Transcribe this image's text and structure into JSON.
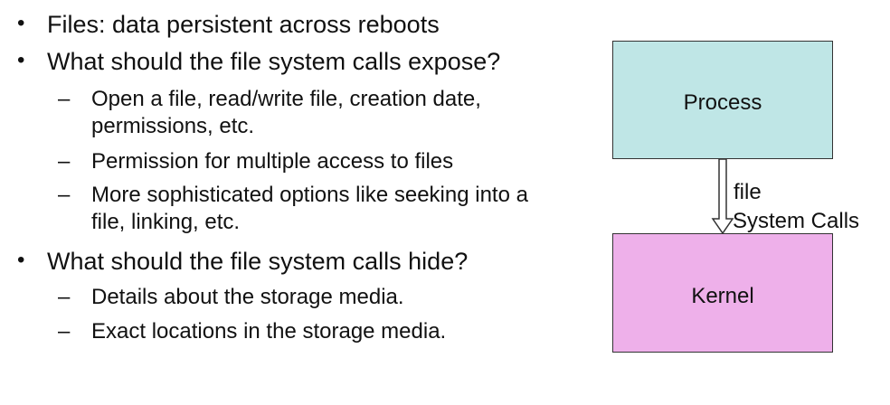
{
  "bullets": [
    {
      "text": "Files: data persistent across reboots"
    },
    {
      "text": "What should the file system calls expose?"
    },
    {
      "text": "What should the file system calls hide?"
    }
  ],
  "expose_items": [
    {
      "lines": [
        "Open a file, read/write file, creation date,",
        "permissions, etc."
      ]
    },
    {
      "lines": [
        "Permission for multiple access to files"
      ]
    },
    {
      "lines": [
        "More sophisticated options like seeking into a",
        "file, linking, etc."
      ]
    }
  ],
  "hide_items": [
    {
      "lines": [
        "Details about the storage media."
      ]
    },
    {
      "lines": [
        "Exact locations in the storage media."
      ]
    }
  ],
  "diagram": {
    "process_label": "Process",
    "kernel_label": "Kernel",
    "arrow_label_line1": "file",
    "arrow_label_line2": "System Calls",
    "process_color": "#bfe6e6",
    "kernel_color": "#eeb0ea"
  }
}
